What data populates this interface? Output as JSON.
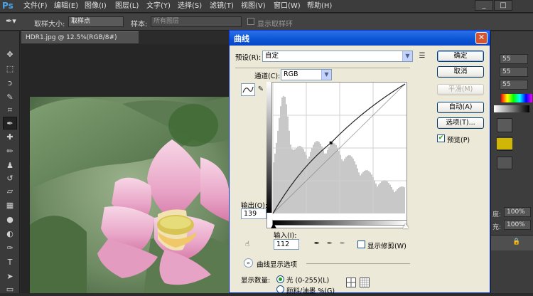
{
  "app": {
    "logo": "Ps"
  },
  "menu": [
    "文件(F)",
    "编辑(E)",
    "图像(I)",
    "图层(L)",
    "文字(Y)",
    "选择(S)",
    "滤镜(T)",
    "视图(V)",
    "窗口(W)",
    "帮助(H)"
  ],
  "window_controls": {
    "minimize": "_",
    "restore": "□"
  },
  "options": {
    "sample_size_label": "取样大小:",
    "sample_size_value": "取样点",
    "sample_label": "样本:",
    "sample_value": "所有图层",
    "show_ring_label": "显示取样环"
  },
  "document": {
    "tab_title": "HDR1.jpg @ 12.5%(RGB/8#)"
  },
  "right_panel": {
    "fields": [
      "55",
      "55",
      "55"
    ],
    "opacity_label": "度:",
    "opacity_value": "100%",
    "fill_label": "充:",
    "fill_value": "100%"
  },
  "dialog": {
    "title": "曲线",
    "close": "✕",
    "preset_label": "预设(R):",
    "preset_value": "自定",
    "channel_label": "通道(C):",
    "channel_value": "RGB",
    "output_label": "输出(O):",
    "output_value": "139",
    "input_label": "输入(I):",
    "input_value": "112",
    "show_clipping_label": "显示修剪(W)",
    "curve_display_options": "曲线显示选项",
    "show_amount_label": "显示数量:",
    "light_option": "光 (0-255)(L)",
    "pigment_option": "颜料/油墨 %(G)",
    "buttons": {
      "ok": "确定",
      "cancel": "取消",
      "smooth": "平滑(M)",
      "auto": "自动(A)",
      "options": "选项(T)...",
      "preview": "预览(P)"
    },
    "preview_checked": true,
    "light_selected": true
  },
  "curve": {
    "point": {
      "input": 112,
      "output": 139
    },
    "range": [
      0,
      255
    ]
  },
  "colors": {
    "accent": "#0a54d6",
    "ps_bg": "#2b2b2b",
    "dialog_bg": "#ece9d8"
  }
}
